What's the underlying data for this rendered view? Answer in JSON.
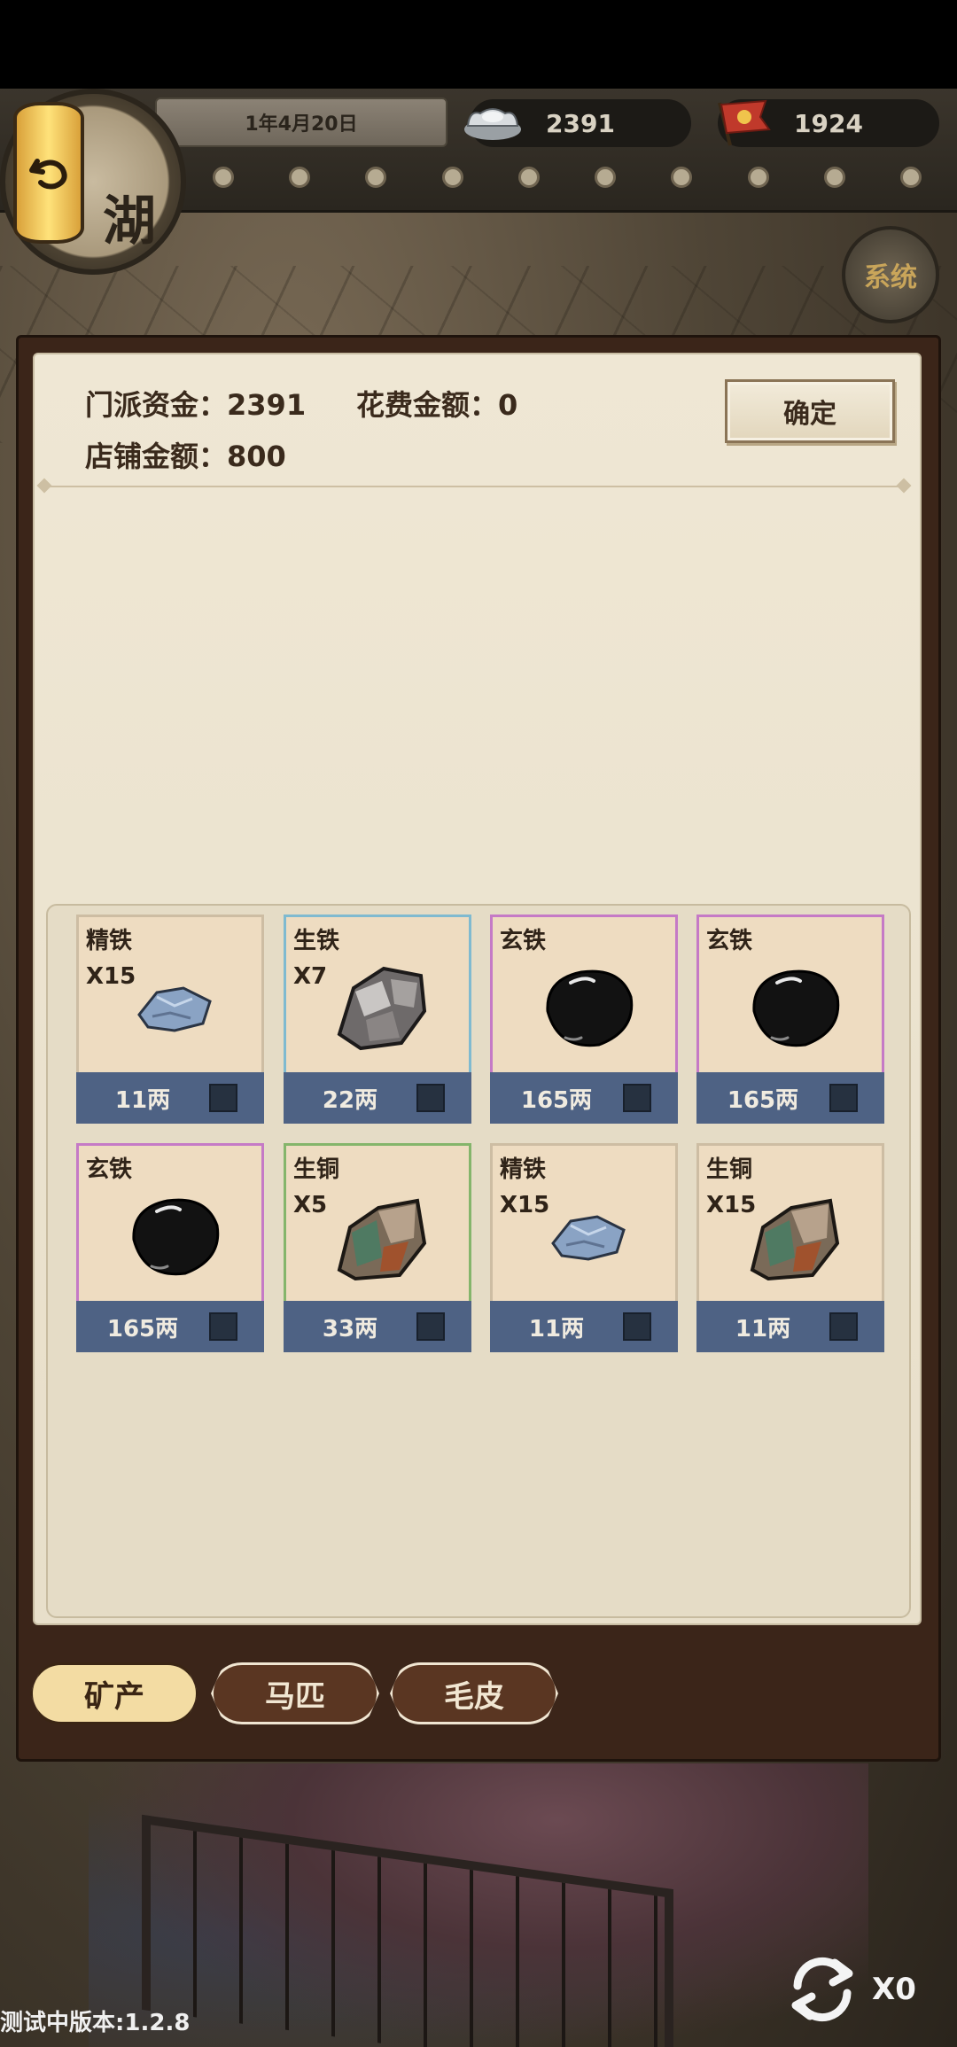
{
  "top_bar": {
    "date": "1年4月20日",
    "silver": "2391",
    "reputation": "1924",
    "medallion_text": "湖",
    "system_label": "系统"
  },
  "panel": {
    "sect_funds_label": "门派资金：",
    "sect_funds_value": "2391",
    "spend_label": "花费金额：",
    "spend_value": "0",
    "shop_label": "店铺金额：",
    "shop_value": "800",
    "confirm_label": "确定"
  },
  "items": [
    {
      "name": "精铁",
      "qty": "X15",
      "price": "11两",
      "rarity": "white",
      "icon": "blue-ore-icon"
    },
    {
      "name": "生铁",
      "qty": "X7",
      "price": "22两",
      "rarity": "blue",
      "icon": "gray-rock-icon"
    },
    {
      "name": "玄铁",
      "qty": "",
      "price": "165两",
      "rarity": "purple",
      "icon": "black-stone-icon"
    },
    {
      "name": "玄铁",
      "qty": "",
      "price": "165两",
      "rarity": "purple",
      "icon": "black-stone-icon"
    },
    {
      "name": "玄铁",
      "qty": "",
      "price": "165两",
      "rarity": "purple",
      "icon": "black-stone-icon"
    },
    {
      "name": "生铜",
      "qty": "X5",
      "price": "33两",
      "rarity": "green",
      "icon": "copper-ore-icon"
    },
    {
      "name": "精铁",
      "qty": "X15",
      "price": "11两",
      "rarity": "white",
      "icon": "blue-ore-icon"
    },
    {
      "name": "生铜",
      "qty": "X15",
      "price": "11两",
      "rarity": "white",
      "icon": "copper-ore-icon"
    }
  ],
  "tabs": [
    {
      "label": "矿产",
      "active": true
    },
    {
      "label": "马匹",
      "active": false
    },
    {
      "label": "毛皮",
      "active": false
    }
  ],
  "footer": {
    "version": "测试中版本:1.2.8",
    "refresh_count": "X0"
  },
  "colors": {
    "price_bar": "#4e6284",
    "tab_active": "#f3dca3",
    "tab_inactive": "#5a3622"
  }
}
